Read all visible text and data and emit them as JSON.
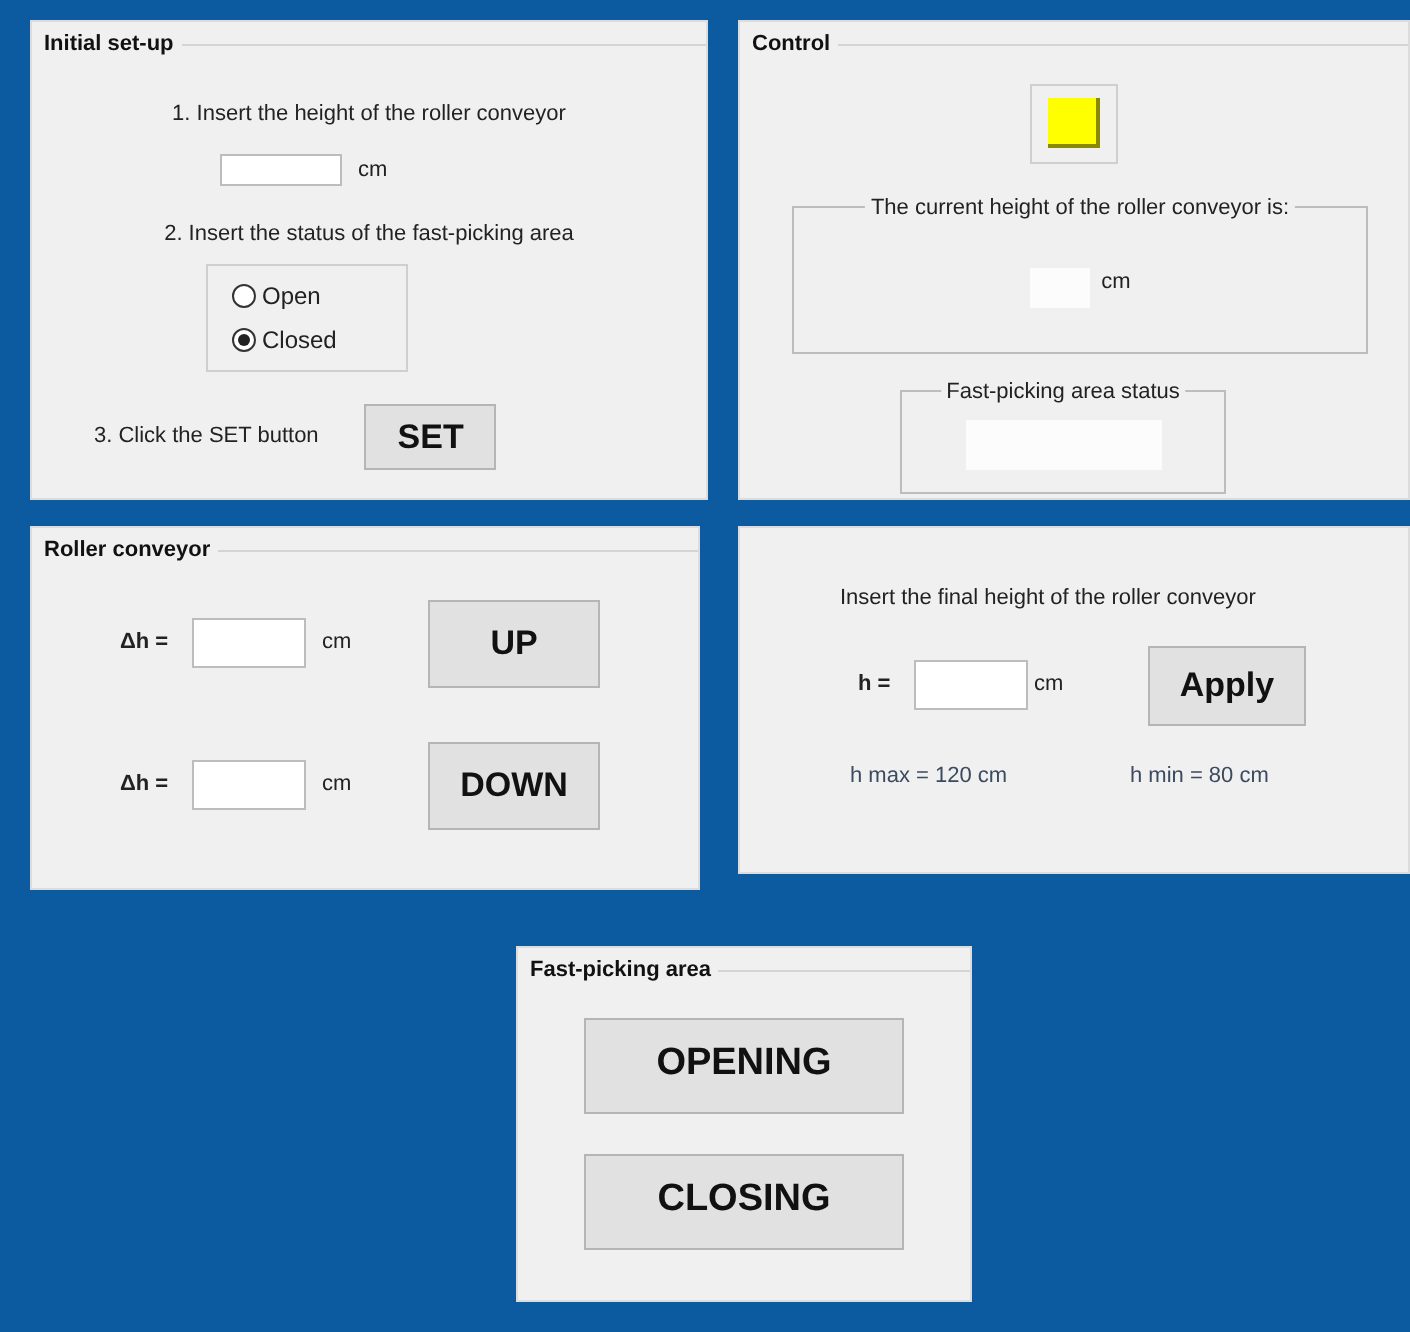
{
  "initial_setup": {
    "title": "Initial set-up",
    "step_1": "1.  Insert the height of the roller conveyor",
    "height_unit": "cm",
    "step_2": "2.  Insert the status of the fast-picking area",
    "status_options": [
      {
        "label": "Open",
        "selected": false
      },
      {
        "label": "Closed",
        "selected": true
      }
    ],
    "step_3": "3.  Click the SET button",
    "set_button": "SET"
  },
  "control": {
    "title": "Control",
    "current_height_group": "The current height of the roller conveyor is:",
    "current_height_unit": "cm",
    "status_group": "Fast-picking area status"
  },
  "roller_conveyor": {
    "title": "Roller conveyor",
    "rows": [
      {
        "label": "Δh =",
        "unit": "cm",
        "button": "UP"
      },
      {
        "label": "Δh =",
        "unit": "cm",
        "button": "DOWN"
      }
    ]
  },
  "final_height": {
    "instruction": "Insert the final height of the roller conveyor",
    "label": "h =",
    "unit": "cm",
    "button": "Apply",
    "max_note": "h max = 120 cm",
    "min_note": "h min = 80 cm"
  },
  "fast_picking": {
    "title": "Fast-picking area",
    "buttons": [
      "OPENING",
      "CLOSING"
    ]
  }
}
